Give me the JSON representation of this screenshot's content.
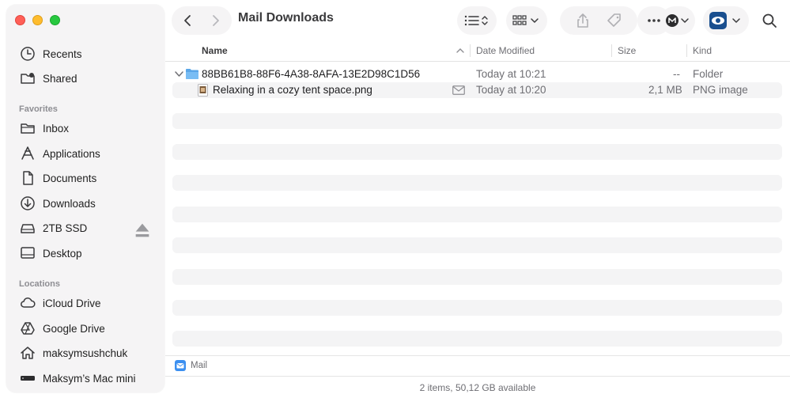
{
  "window": {
    "title": "Mail Downloads"
  },
  "sidebar": {
    "top_items": [
      {
        "label": "Recents",
        "icon": "clock-icon"
      },
      {
        "label": "Shared",
        "icon": "shared-folder-icon"
      }
    ],
    "favorites_header": "Favorites",
    "favorites": [
      {
        "label": "Inbox",
        "icon": "folder-icon"
      },
      {
        "label": "Applications",
        "icon": "applications-icon"
      },
      {
        "label": "Documents",
        "icon": "document-icon"
      },
      {
        "label": "Downloads",
        "icon": "download-icon"
      },
      {
        "label": "2TB SSD",
        "icon": "drive-icon"
      },
      {
        "label": "Desktop",
        "icon": "desktop-icon"
      }
    ],
    "locations_header": "Locations",
    "locations": [
      {
        "label": "iCloud Drive",
        "icon": "cloud-icon"
      },
      {
        "label": "Google Drive",
        "icon": "google-drive-icon"
      },
      {
        "label": "maksymsushchuk",
        "icon": "home-icon"
      },
      {
        "label": "Maksym’s Mac mini",
        "icon": "mac-mini-icon"
      }
    ]
  },
  "columns": {
    "name": "Name",
    "date_modified": "Date Modified",
    "size": "Size",
    "kind": "Kind"
  },
  "rows": [
    {
      "name": "88BB61B8-88F6-4A38-8AFA-13E2D98C1D56",
      "date": "Today at 10:21",
      "size": "--",
      "kind": "Folder",
      "icon": "folder-icon",
      "expanded": true
    },
    {
      "name": "Relaxing in a cozy tent space.png",
      "date": "Today at 10:20",
      "size": "2,1 MB",
      "kind": "PNG image",
      "icon": "image-file-icon",
      "badge": "mail-icon"
    }
  ],
  "pathbar": {
    "label": "Mail"
  },
  "statusbar": {
    "text": "2 items, 50,12 GB available"
  },
  "colors": {
    "accent": "#1e6fd9",
    "sidebar_bg": "#f5f4f5",
    "close": "#ff5f57",
    "minimize": "#febc2e",
    "maximize": "#28c840"
  }
}
